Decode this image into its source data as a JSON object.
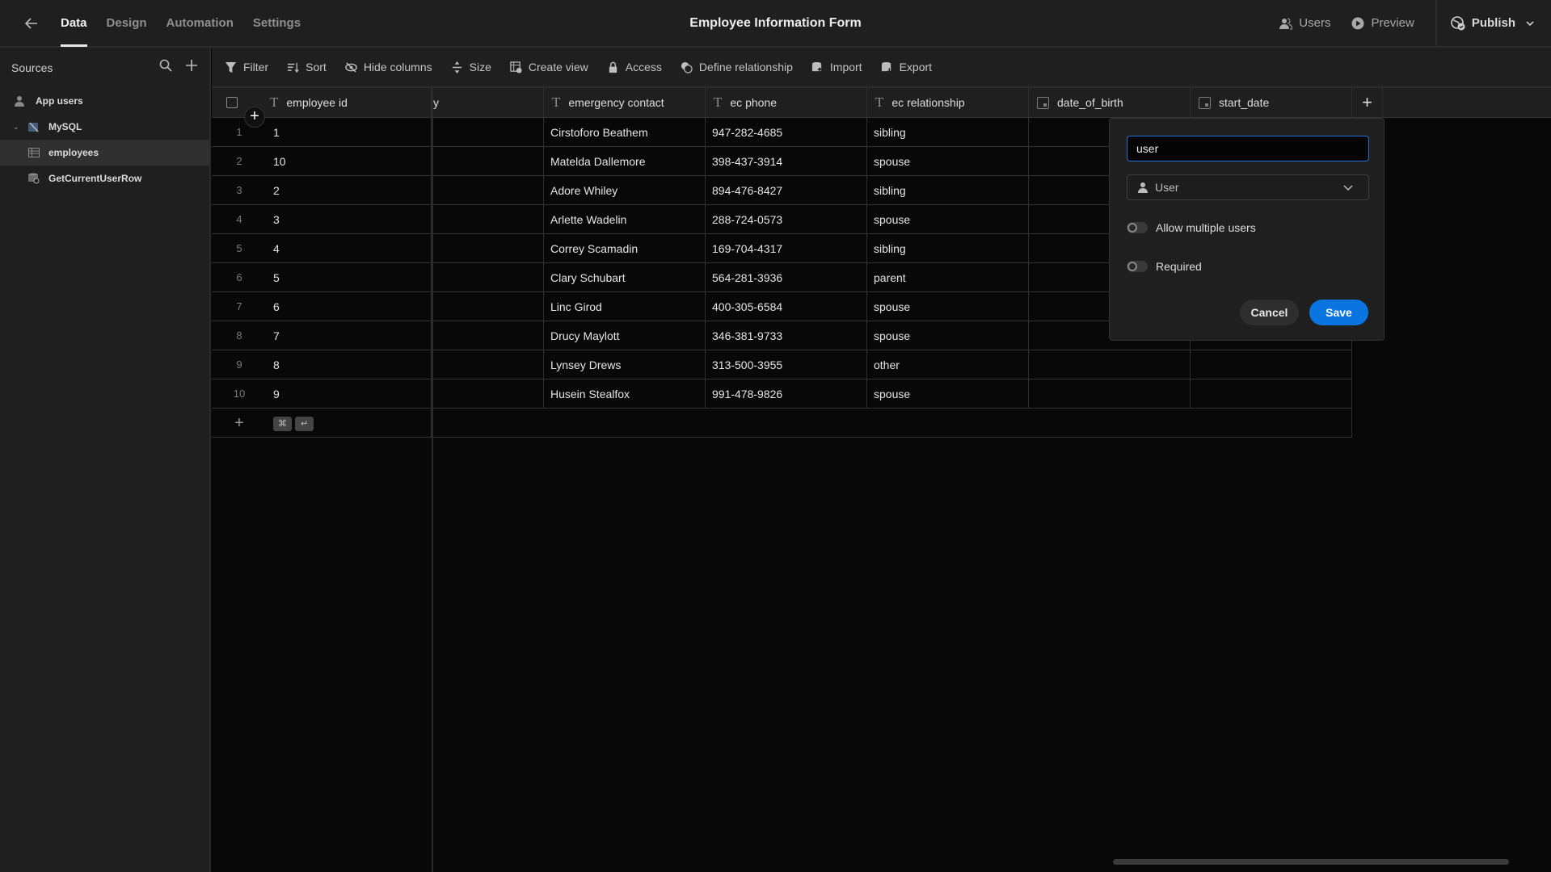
{
  "topbar": {
    "tabs": [
      {
        "label": "Data",
        "active": true
      },
      {
        "label": "Design",
        "active": false
      },
      {
        "label": "Automation",
        "active": false
      },
      {
        "label": "Settings",
        "active": false
      }
    ],
    "title": "Employee Information Form",
    "users_label": "Users",
    "preview_label": "Preview",
    "publish_label": "Publish"
  },
  "sidebar": {
    "heading": "Sources",
    "items": [
      {
        "label": "App users",
        "icon": "users-icon"
      },
      {
        "label": "MySQL",
        "icon": "mysql-icon"
      },
      {
        "label": "employees",
        "icon": "table-icon",
        "selected": true
      },
      {
        "label": "GetCurrentUserRow",
        "icon": "query-icon"
      }
    ]
  },
  "toolbar": {
    "items": [
      {
        "label": "Filter",
        "icon": "filter-icon"
      },
      {
        "label": "Sort",
        "icon": "sort-icon"
      },
      {
        "label": "Hide columns",
        "icon": "hide-columns-icon"
      },
      {
        "label": "Size",
        "icon": "size-icon"
      },
      {
        "label": "Create view",
        "icon": "create-view-icon"
      },
      {
        "label": "Access",
        "icon": "lock-icon"
      },
      {
        "label": "Define relationship",
        "icon": "relationship-icon"
      },
      {
        "label": "Import",
        "icon": "import-icon"
      },
      {
        "label": "Export",
        "icon": "export-icon"
      }
    ]
  },
  "table": {
    "columns": [
      {
        "label": "employee id",
        "type": "text"
      },
      {
        "label": "y",
        "type": "partial"
      },
      {
        "label": "emergency contact",
        "type": "text"
      },
      {
        "label": "ec phone",
        "type": "text"
      },
      {
        "label": "ec relationship",
        "type": "text"
      },
      {
        "label": "date_of_birth",
        "type": "date"
      },
      {
        "label": "start_date",
        "type": "date"
      }
    ],
    "rows": [
      {
        "num": "1",
        "employee_id": "1",
        "contact": "Cirstoforo Beathem",
        "phone": "947-282-4685",
        "relationship": "sibling"
      },
      {
        "num": "2",
        "employee_id": "10",
        "contact": "Matelda Dallemore",
        "phone": "398-437-3914",
        "relationship": "spouse"
      },
      {
        "num": "3",
        "employee_id": "2",
        "contact": "Adore Whiley",
        "phone": "894-476-8427",
        "relationship": "sibling"
      },
      {
        "num": "4",
        "employee_id": "3",
        "contact": "Arlette Wadelin",
        "phone": "288-724-0573",
        "relationship": "spouse"
      },
      {
        "num": "5",
        "employee_id": "4",
        "contact": "Correy Scamadin",
        "phone": "169-704-4317",
        "relationship": "sibling"
      },
      {
        "num": "6",
        "employee_id": "5",
        "contact": "Clary Schubart",
        "phone": "564-281-3936",
        "relationship": "parent"
      },
      {
        "num": "7",
        "employee_id": "6",
        "contact": "Linc Girod",
        "phone": "400-305-6584",
        "relationship": "spouse"
      },
      {
        "num": "8",
        "employee_id": "7",
        "contact": "Drucy Maylott",
        "phone": "346-381-9733",
        "relationship": "spouse"
      },
      {
        "num": "9",
        "employee_id": "8",
        "contact": "Lynsey Drews",
        "phone": "313-500-3955",
        "relationship": "other"
      },
      {
        "num": "10",
        "employee_id": "9",
        "contact": "Husein Stealfox",
        "phone": "991-478-9826",
        "relationship": "spouse"
      }
    ],
    "shortcut_keys": [
      "⌘",
      "↵"
    ]
  },
  "popup": {
    "name_value": "user",
    "type_value": "User",
    "allow_multiple_label": "Allow multiple users",
    "allow_multiple_on": false,
    "required_label": "Required",
    "required_on": false,
    "cancel_label": "Cancel",
    "save_label": "Save",
    "accent_color": "#0a75e0"
  }
}
